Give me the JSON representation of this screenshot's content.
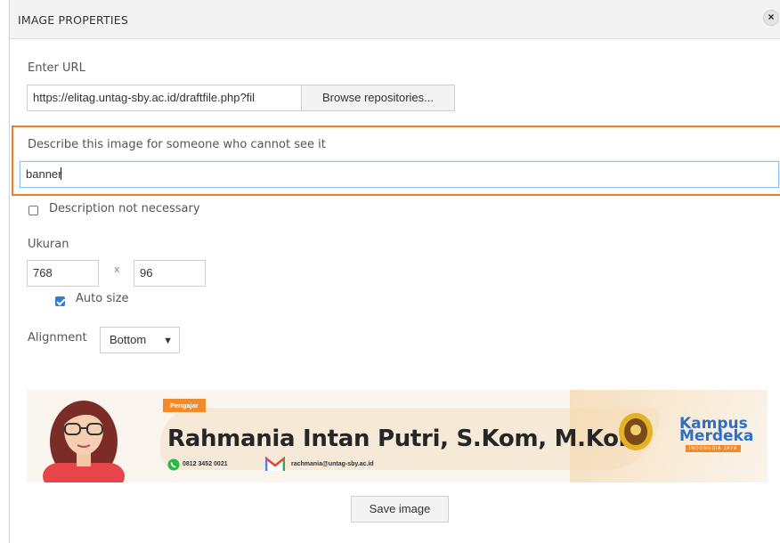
{
  "dialog": {
    "title": "IMAGE PROPERTIES",
    "close_glyph": "×"
  },
  "url": {
    "label": "Enter URL",
    "value": "https://elitag.untag-sby.ac.id/draftfile.php?fil",
    "browse_label": "Browse repositories..."
  },
  "description": {
    "label": "Describe this image for someone who cannot see it",
    "value": "banner",
    "not_necessary_label": "Description not necessary",
    "not_necessary_checked": false
  },
  "size": {
    "label": "Ukuran",
    "width": "768",
    "separator": "x",
    "height": "96",
    "auto_size_label": "Auto size",
    "auto_size_checked": true
  },
  "alignment": {
    "label": "Alignment",
    "selected": "Bottom"
  },
  "banner": {
    "tag": "Pengajar",
    "name": "Rahmania Intan Putri, S.Kom, M.Kom",
    "phone": "0812 3452 0021",
    "email": "rachmania@untag-sby.ac.id",
    "logo_line1": "Kampus",
    "logo_line2": "Merdeka",
    "logo_line3": "INDONESIA JAYA"
  },
  "save_label": "Save image",
  "colors": {
    "highlight": "#ee7d2b",
    "checkbox_on": "#2f7bd6",
    "focus_border": "#8dc0ee",
    "banner_accent": "#f08a2a",
    "logo_blue": "#2a6fc9"
  }
}
